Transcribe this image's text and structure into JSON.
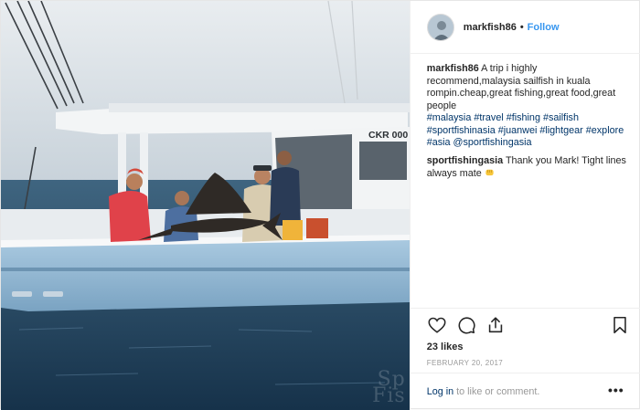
{
  "post": {
    "username": "markfish86",
    "separator": "•",
    "follow_label": "Follow",
    "caption": {
      "username": "markfish86",
      "text": "A trip i highly recommend,malaysia sailfish in kuala rompin.cheap,great fishing,great food,great people",
      "hashtags": "#malaysia #travel #fishing #sailfish #sportfishinasia #juanwei #lightgear #explore #asia @sportfishingasia"
    },
    "reply": {
      "username": "sportfishingasia",
      "text": "Thank you Mark! Tight lines always mate"
    },
    "likes": "23 likes",
    "date": "FEBRUARY 20, 2017",
    "footer": {
      "login": "Log in",
      "rest": "to like or comment.",
      "more": "•••"
    },
    "photo": {
      "boat_id": "CKR 000",
      "watermark": "Sp\nFis"
    }
  },
  "icons": {
    "like": "heart-icon",
    "comment": "comment-bubble-icon",
    "share": "share-icon",
    "save": "bookmark-icon",
    "emoji": "fist-emoji"
  },
  "colors": {
    "link_blue": "#3897f0",
    "hashtag_blue": "#003569",
    "muted_gray": "#999999",
    "hull_blue": "#8fb6d4",
    "sea": "#1f3a52"
  }
}
